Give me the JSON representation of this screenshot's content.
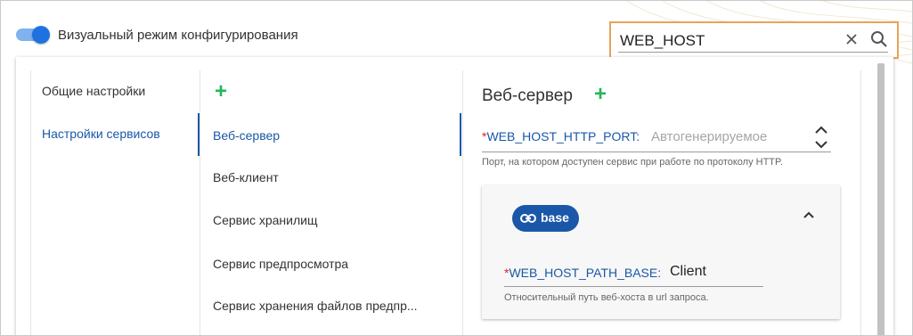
{
  "config_mode": {
    "label": "Визуальный режим конфигурирования",
    "enabled": true,
    "accent_color": "#1e72e0"
  },
  "search": {
    "value": "WEB_HOST",
    "highlight_color": "#e7a35a"
  },
  "categories": [
    {
      "label": "Общие настройки",
      "active": false
    },
    {
      "label": "Настройки сервисов",
      "active": true
    }
  ],
  "services": [
    {
      "label": "Веб-сервер",
      "active": true
    },
    {
      "label": "Веб-клиент",
      "active": false
    },
    {
      "label": "Сервис хранилищ",
      "active": false
    },
    {
      "label": "Сервис предпросмотра",
      "active": false
    },
    {
      "label": "Сервис хранения файлов предпр...",
      "active": false
    }
  ],
  "detail": {
    "title": "Веб-сервер",
    "port_field": {
      "required_mark": "*",
      "key": "WEB_HOST_HTTP_PORT:",
      "placeholder": "Автогенерируемое",
      "hint": "Порт, на котором доступен сервис при работе по протоколу HTTP."
    },
    "base_group": {
      "chip_label": "base",
      "expanded": true,
      "field": {
        "required_mark": "*",
        "key": "WEB_HOST_PATH_BASE:",
        "value": "Client",
        "hint": "Относительный путь веб-хоста в url запроса."
      }
    }
  },
  "colors": {
    "link_blue": "#1a57a8",
    "add_green": "#27b55a",
    "required_red": "#e01f1f"
  }
}
